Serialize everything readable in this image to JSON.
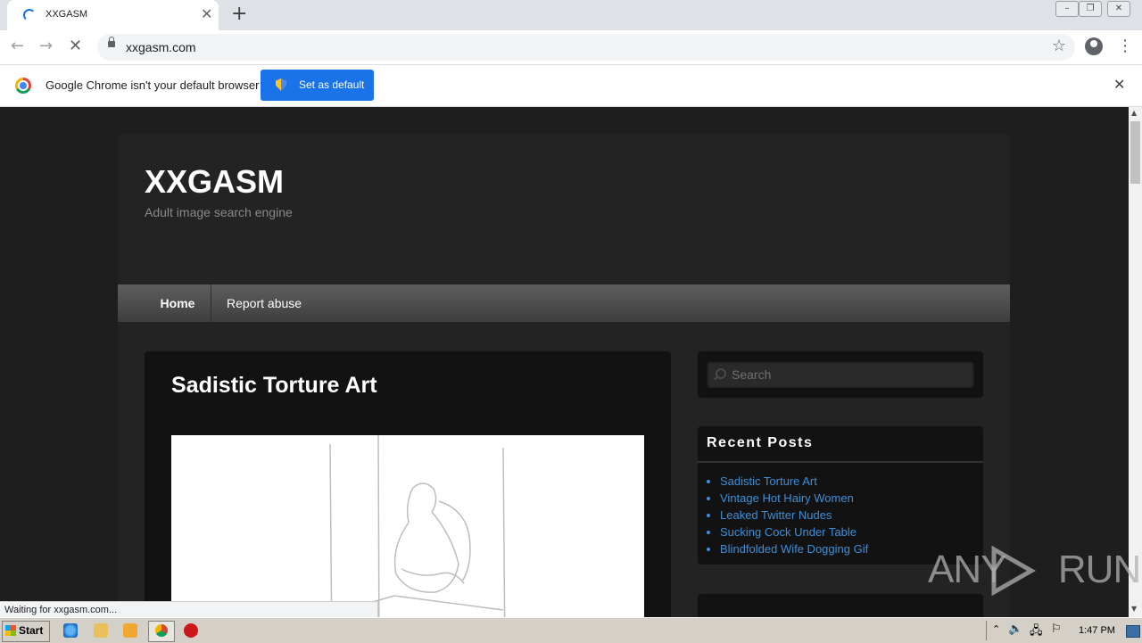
{
  "tab": {
    "title": "XXGASM"
  },
  "address_bar": {
    "url": "xxgasm.com"
  },
  "infobar": {
    "message": "Google Chrome isn't your default browser",
    "button_label": "Set as default"
  },
  "site": {
    "title": "XXGASM",
    "tagline": "Adult image search engine",
    "nav": [
      {
        "label": "Home"
      },
      {
        "label": "Report abuse"
      }
    ],
    "article_title": "Sadistic Torture Art",
    "search_placeholder": "Search",
    "recent_posts_title": "Recent Posts",
    "recent_posts": [
      {
        "label": "Sadistic Torture Art"
      },
      {
        "label": "Vintage Hot Hairy Women"
      },
      {
        "label": "Leaked Twitter Nudes"
      },
      {
        "label": "Sucking Cock Under Table"
      },
      {
        "label": "Blindfolded Wife Dogging Gif"
      }
    ]
  },
  "status_bar": {
    "text": "Waiting for xxgasm.com..."
  },
  "watermark": {
    "text": "ANY RUN"
  },
  "taskbar": {
    "start_label": "Start",
    "clock": "1:47 PM"
  },
  "colors": {
    "accent": "#1a73e8",
    "link": "#3d8fd8",
    "page_bg": "#1e1e1e",
    "panel_bg": "#121212"
  }
}
